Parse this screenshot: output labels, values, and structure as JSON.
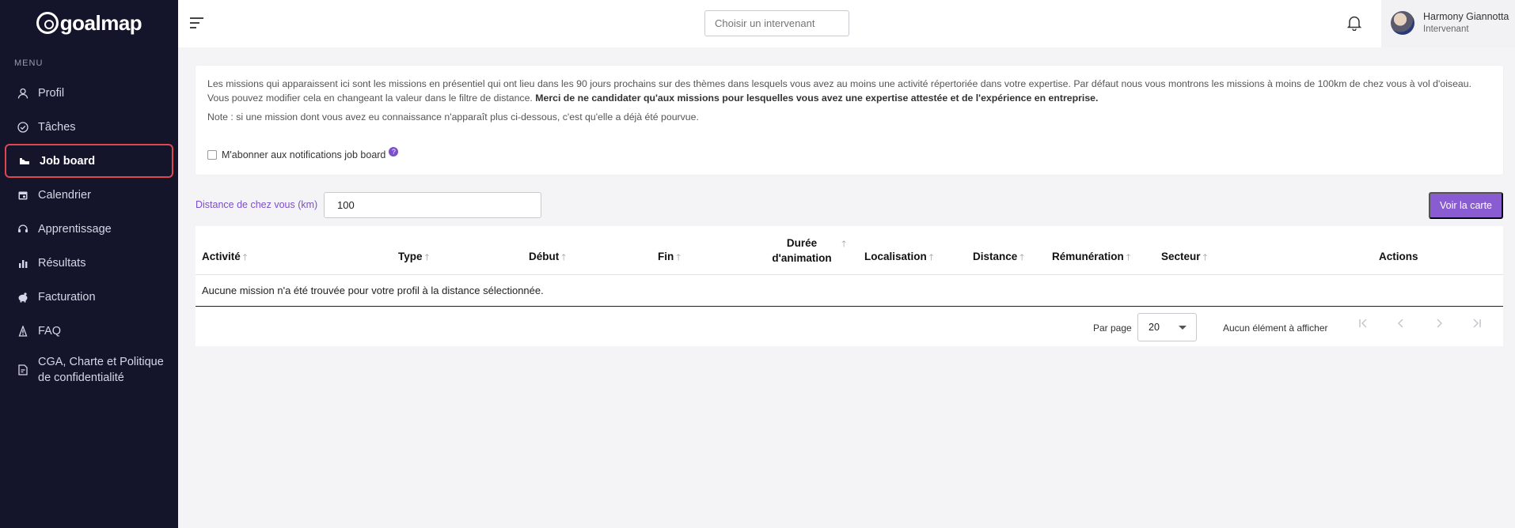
{
  "brand": {
    "name": "goalmap"
  },
  "sidebar": {
    "menu_title": "MENU",
    "items": [
      {
        "label": "Profil",
        "icon": "user-icon"
      },
      {
        "label": "Tâches",
        "icon": "check-circle-icon"
      },
      {
        "label": "Job board",
        "icon": "briefcase-icon",
        "active": true
      },
      {
        "label": "Calendrier",
        "icon": "calendar-icon"
      },
      {
        "label": "Apprentissage",
        "icon": "learning-icon"
      },
      {
        "label": "Résultats",
        "icon": "bar-chart-icon"
      },
      {
        "label": "Facturation",
        "icon": "piggy-bank-icon"
      },
      {
        "label": "FAQ",
        "icon": "faq-icon"
      },
      {
        "label": "CGA, Charte et Politique de confidentialité",
        "icon": "document-edit-icon"
      }
    ]
  },
  "topbar": {
    "picker_placeholder": "Choisir un intervenant",
    "user_name": "Harmony Giannotta",
    "user_role": "Intervenant"
  },
  "info": {
    "paragraph_plain": "Les missions qui apparaissent ici sont les missions en présentiel qui ont lieu dans les 90 jours prochains sur des thèmes dans lesquels vous avez au moins une activité répertoriée dans votre expertise. Par défaut nous vous montrons les missions à moins de 100km de chez vous à vol d'oiseau. Vous pouvez modifier cela en changeant la valeur dans le filtre de distance.",
    "paragraph_bold": "Merci de ne candidater qu'aux missions pour lesquelles vous avez une expertise attestée et de l'expérience en entreprise.",
    "note": "Note : si une mission dont vous avez eu connaissance n'apparaît plus ci-dessous, c'est qu'elle a déjà été pourvue.",
    "subscribe_label": "M'abonner aux notifications job board",
    "help_glyph": "?"
  },
  "filter": {
    "distance_label": "Distance de chez vous (km)",
    "distance_value": "100",
    "map_button": "Voir la carte"
  },
  "table": {
    "columns": {
      "activite": "Activité",
      "type": "Type",
      "debut": "Début",
      "fin": "Fin",
      "duree_line1": "Durée",
      "duree_line2": "d'animation",
      "localisation": "Localisation",
      "distance": "Distance",
      "remuneration": "Rémunération",
      "secteur": "Secteur",
      "actions": "Actions"
    },
    "empty_message": "Aucune mission n'a été trouvée pour votre profil à la distance sélectionnée."
  },
  "pagination": {
    "per_page_label": "Par page",
    "per_page_value": "20",
    "status": "Aucun élément à afficher"
  }
}
